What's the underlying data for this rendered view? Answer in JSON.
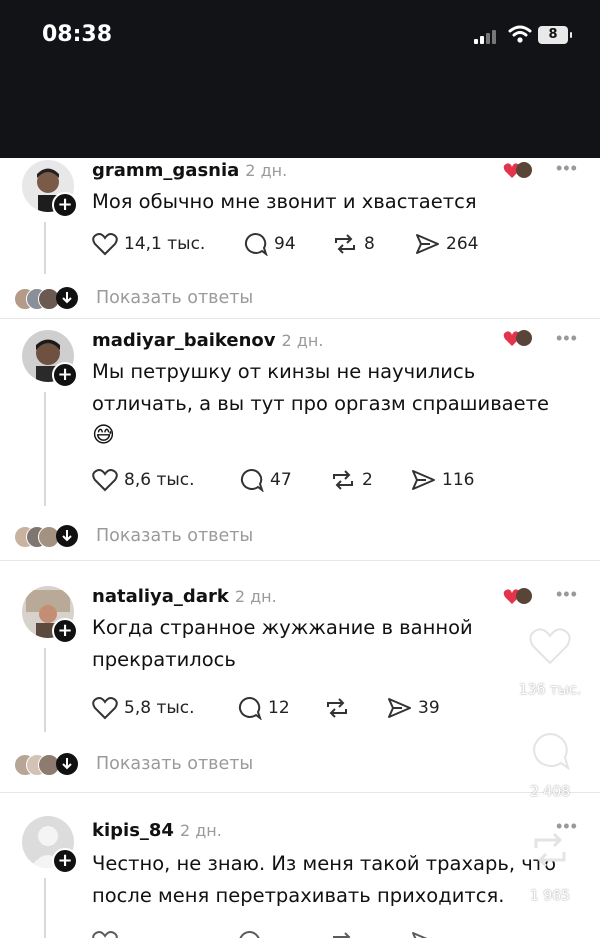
{
  "status_bar": {
    "time": "08:38",
    "battery": "8"
  },
  "comments": [
    {
      "username": "gramm_gasnia",
      "time": "2 дн.",
      "text": "Моя обычно мне звонит и хвастается",
      "likes": "14,1 тыс.",
      "replies": "94",
      "reposts": "8",
      "shares": "264"
    },
    {
      "username": "madiyar_baikenov",
      "time": "2 дн.",
      "text": "Мы петрушку от кинзы не научились отличать, а вы тут про оргазм спрашиваете",
      "emoji": "😅",
      "likes": "8,6 тыс.",
      "replies": "47",
      "reposts": "2",
      "shares": "116"
    },
    {
      "username": "nataliya_dark",
      "time": "2 дн.",
      "text": "Когда странное жужжание в ванной прекратилось",
      "likes": "5,8 тыс.",
      "replies": "12",
      "reposts": "",
      "shares": "39"
    },
    {
      "username": "kipis_84",
      "time": "2 дн.",
      "text": "Честно, не знаю. Из меня такой трахарь, что после меня перетрахивать приходится.",
      "likes": "",
      "replies": "",
      "reposts": "",
      "shares": ""
    }
  ],
  "show_replies_label": "Показать ответы",
  "side_actions": {
    "likes": "136 тыс.",
    "comments": "2 408",
    "shares": "1 965"
  },
  "icons": [
    "heart-icon",
    "comment-icon",
    "repost-icon",
    "share-icon",
    "plus-icon",
    "more-icon",
    "signal-icon",
    "wifi-icon",
    "battery-icon"
  ]
}
